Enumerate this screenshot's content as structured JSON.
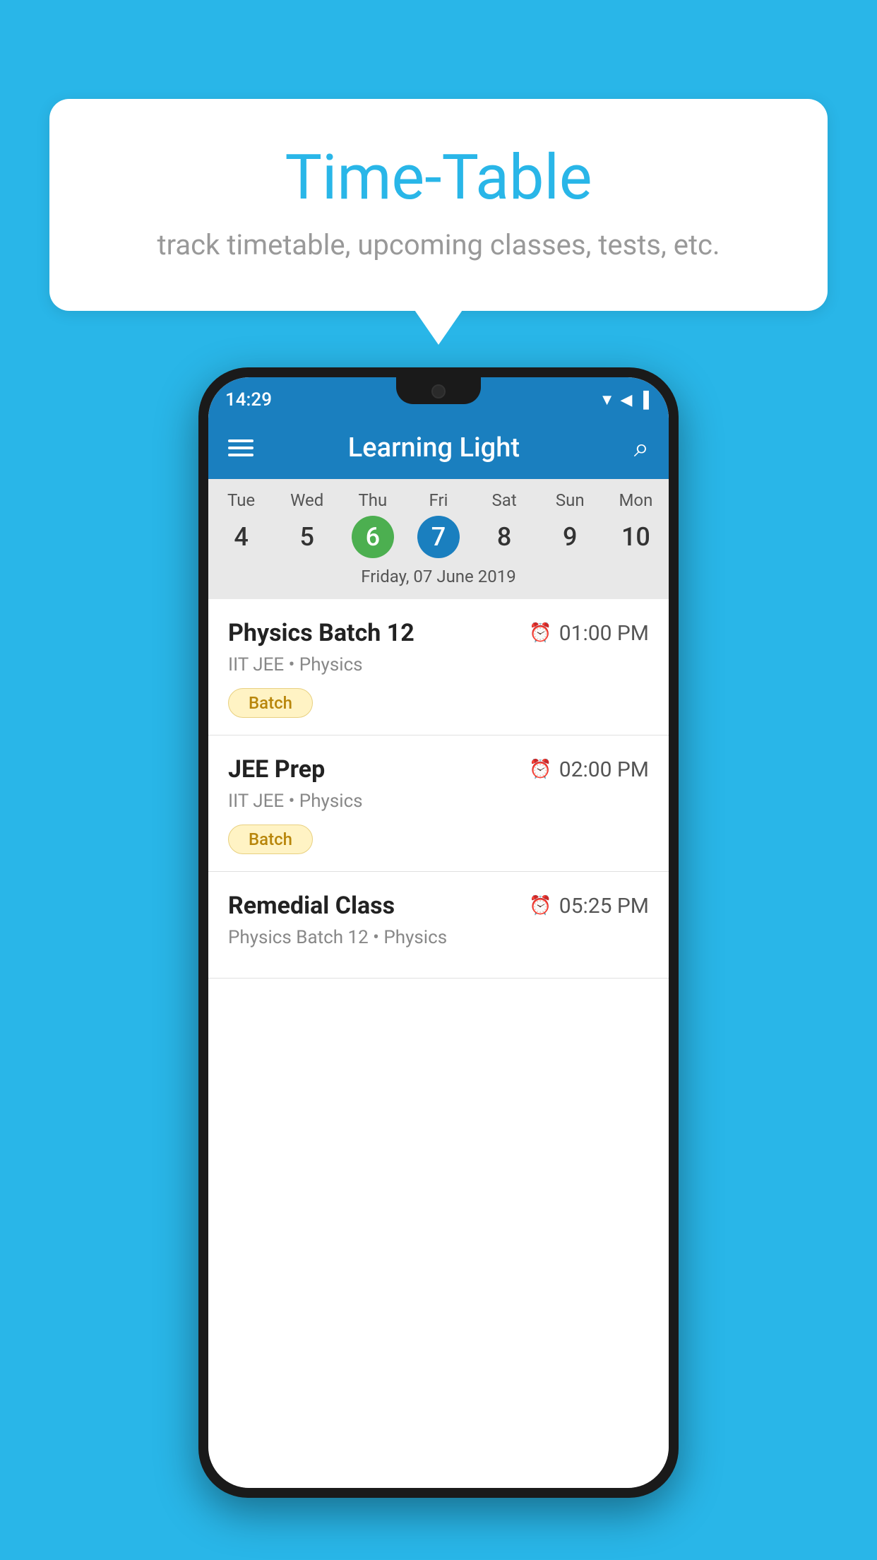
{
  "background_color": "#29B6E8",
  "bubble": {
    "title": "Time-Table",
    "subtitle": "track timetable, upcoming classes, tests, etc."
  },
  "status_bar": {
    "time": "14:29"
  },
  "app_header": {
    "title": "Learning Light",
    "menu_icon": "menu-icon",
    "search_icon": "search-icon"
  },
  "calendar": {
    "selected_date_label": "Friday, 07 June 2019",
    "days": [
      {
        "label": "Tue",
        "number": "4",
        "state": "normal"
      },
      {
        "label": "Wed",
        "number": "5",
        "state": "normal"
      },
      {
        "label": "Thu",
        "number": "6",
        "state": "today"
      },
      {
        "label": "Fri",
        "number": "7",
        "state": "selected"
      },
      {
        "label": "Sat",
        "number": "8",
        "state": "normal"
      },
      {
        "label": "Sun",
        "number": "9",
        "state": "normal"
      },
      {
        "label": "Mon",
        "number": "10",
        "state": "normal"
      }
    ]
  },
  "classes": [
    {
      "name": "Physics Batch 12",
      "time": "01:00 PM",
      "meta": "IIT JEE • Physics",
      "badge": "Batch"
    },
    {
      "name": "JEE Prep",
      "time": "02:00 PM",
      "meta": "IIT JEE • Physics",
      "badge": "Batch"
    },
    {
      "name": "Remedial Class",
      "time": "05:25 PM",
      "meta": "Physics Batch 12 • Physics",
      "badge": ""
    }
  ]
}
